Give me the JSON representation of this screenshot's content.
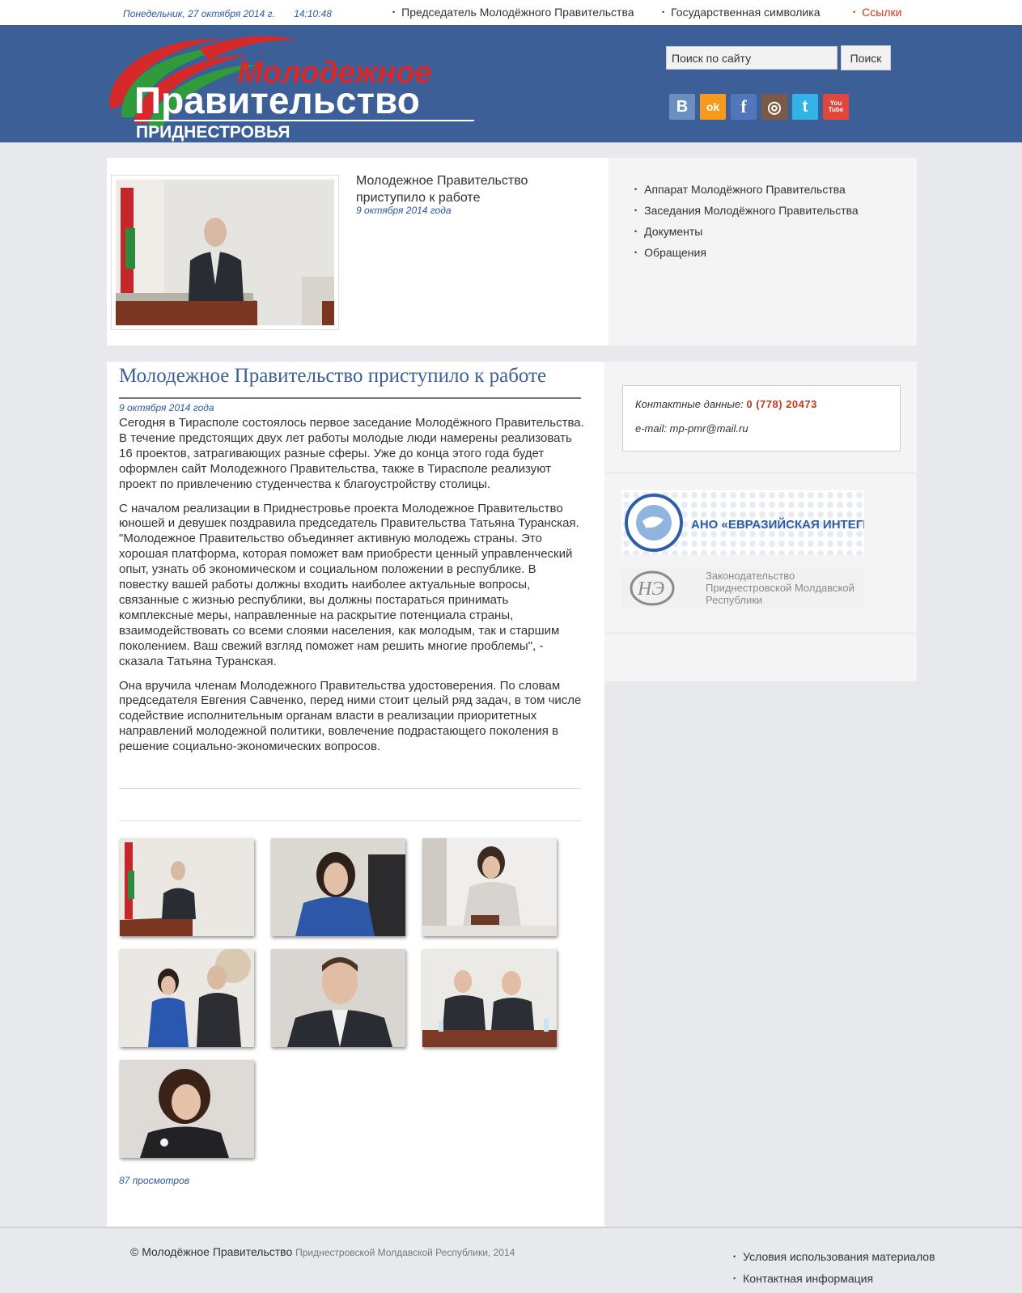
{
  "topbar": {
    "date": "Понедельник, 27 октября 2014 г.",
    "time": "14:10:48",
    "nav": [
      "Председатель Молодёжного Правительства",
      "Государственная символика",
      "Ссылки"
    ]
  },
  "header": {
    "logo_line1": "Молодежное",
    "logo_line2": "Правительство",
    "logo_line3": "ПРИДНЕСТРОВЬЯ",
    "search_placeholder": "Поиск по сайту",
    "search_button": "Поиск",
    "social": [
      {
        "icon": "vk-icon",
        "glyph": "B",
        "color": "#6b8fc0"
      },
      {
        "icon": "odnoklassniki-icon",
        "glyph": "ok",
        "color": "#f59a1d"
      },
      {
        "icon": "facebook-icon",
        "glyph": "f",
        "color": "#5176b9"
      },
      {
        "icon": "instagram-icon",
        "glyph": "◎",
        "color": "#7a5a46"
      },
      {
        "icon": "twitter-icon",
        "glyph": "t",
        "color": "#33b2e6"
      },
      {
        "icon": "youtube-icon",
        "glyph": "You Tube",
        "color": "#e0463c"
      }
    ]
  },
  "featured": {
    "title": "Молодежное Правительство приступило к работе",
    "date": "9 октября 2014 года"
  },
  "side_menu": [
    "Аппарат Молодёжного Правительства",
    "Заседания Молодёжного Правительства",
    "Документы",
    "Обращения"
  ],
  "article": {
    "title": "Молодежное Правительство приступило к работе",
    "date": "9 октября 2014 года",
    "paragraphs": [
      "Сегодня в Тирасполе состоялось первое заседание Молодёжного Правительства. В течение предстоящих двух лет работы молодые люди намерены реализовать 16 проектов, затрагивающих разные сферы. Уже до конца этого года будет оформлен сайт Молодежного Правительства, также в Тирасполе реализуют проект по привлечению студенчества к благоустройству столицы.",
      "С началом реализации в Приднестровье проекта Молодежное Правительство юношей и девушек поздравила председатель Правительства Татьяна Туранская. \"Молодежное Правительство объединяет активную молодежь страны. Это хорошая платформа, которая поможет вам приобрести ценный управленческий опыт, узнать об экономическом и социальном положении в республике. В повестку вашей работы должны входить наиболее актуальные вопросы, связанные с жизнью республики, вы должны постараться принимать комплексные меры, направленные на раскрытие потенциала страны, взаимодействовать со всеми слоями населения, как молодым, так и старшим поколением. Ваш свежий взгляд поможет нам решить многие проблемы\", - сказала Татьяна Туранская.",
      "Она вручила членам Молодежного Правительства удостоверения. По словам председателя Евгения Савченко, перед ними стоит целый ряд задач, в том числе содействие исполнительным органам власти в реализации приоритетных направлений молодежной политики, вовлечение подрастающего поколения в решение социально-экономических вопросов."
    ],
    "views": "87 просмотров"
  },
  "contact": {
    "label": "Контактные данные:",
    "phone": "0 (778) 20473",
    "email": "e-mail: mp-pmr@mail.ru"
  },
  "banners": {
    "eurasian": "АНО «ЕВРАЗИЙСКАЯ ИНТЕГРАЦИЯ»",
    "eurasian_ring": "ЕВРАЗИЙСКАЯ ИНТЕГРАЦИЯ",
    "law_line1": "Законодательство",
    "law_line2": "Приднестровской Молдавской",
    "law_line3": "Республики"
  },
  "footer": {
    "copyright_main": "© Молодёжное Правительство",
    "copyright_rest": "Приднестровской Молдавской Республики, 2014",
    "links": [
      "Условия использования материалов",
      "Контактная информация"
    ]
  }
}
